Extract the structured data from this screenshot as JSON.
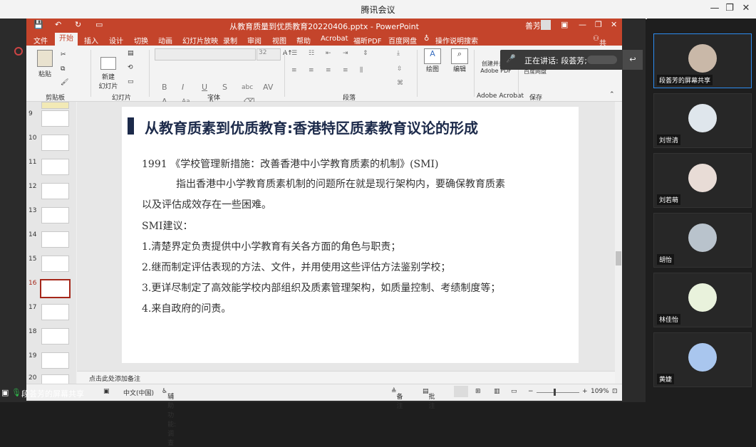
{
  "app": {
    "title": "腾讯会议"
  },
  "ppt": {
    "title": "从教育质量到优质教育20220406.pptx - PowerPoint",
    "user": "善芳",
    "menu": [
      "文件",
      "开始",
      "插入",
      "设计",
      "切换",
      "动画",
      "幻灯片放映",
      "录制",
      "审阅",
      "视图",
      "帮助",
      "Acrobat",
      "福昕PDF",
      "百度网盘"
    ],
    "tell_me": "操作说明搜索",
    "share": "共享",
    "ribbon": {
      "paste": "粘贴",
      "new_slide": "新建\n幻灯片",
      "group_clipboard": "剪贴板",
      "group_slides": "幻灯片",
      "group_font": "字体",
      "font_size": "32",
      "group_paragraph": "段落",
      "drawing": "绘图",
      "editing": "编辑",
      "create_share": "创建并共享\nAdobe PDF",
      "save_baidu": "保存到\n百度网盘",
      "group_acrobat": "Adobe Acrobat",
      "group_save": "保存"
    },
    "thumb_numbers": [
      "9",
      "10",
      "11",
      "12",
      "13",
      "14",
      "15",
      "16",
      "17",
      "18",
      "19",
      "20"
    ],
    "selected_slide": "16",
    "slide": {
      "title": "从教育质素到优质教育:香港特区质素教育议论的形成",
      "lines": [
        "1991 《学校管理新措施：改善香港中小学教育质素的机制》(SMI)",
        "指出香港中小学教育质素机制的问题所在就是现行架构内，要确保教育质素",
        "以及评估成效存在一些困难。",
        "SMI建议：",
        "1.清楚界定负责提供中小学教育有关各方面的角色与职责；",
        "2.继而制定评估表现的方法、文件，并用使用这些评估方法鉴别学校；",
        "3.更详尽制定了高效能学校内部组织及质素管理架构，如质量控制、考绩制度等；",
        "4.来自政府的问责。"
      ]
    },
    "notes_placeholder": "点击此处添加备注",
    "status": {
      "language": "中文(中国)",
      "accessibility": "辅助功能: 调查",
      "notes": "备注",
      "comments": "批注",
      "zoom": "109%"
    }
  },
  "speaking": "正在讲话: 段荟芳;",
  "share_label": "段荟芳的屏幕共享",
  "participants": [
    {
      "name": "段荟芳的屏幕共享",
      "avatar_color": "#c9b8a8"
    },
    {
      "name": "刘世清",
      "avatar_color": "#dfe6ec"
    },
    {
      "name": "刘若萌",
      "avatar_color": "#e8dcd6"
    },
    {
      "name": "胡怡",
      "avatar_color": "#b9c3cc"
    },
    {
      "name": "林佳怡",
      "avatar_color": "#e9f2dc"
    },
    {
      "name": "黄婕",
      "avatar_color": "#a9c6ee"
    }
  ],
  "colors": {
    "ppt_red": "#c4442b",
    "title_navy": "#1c2a4a",
    "active_border": "#2d8cf0"
  }
}
